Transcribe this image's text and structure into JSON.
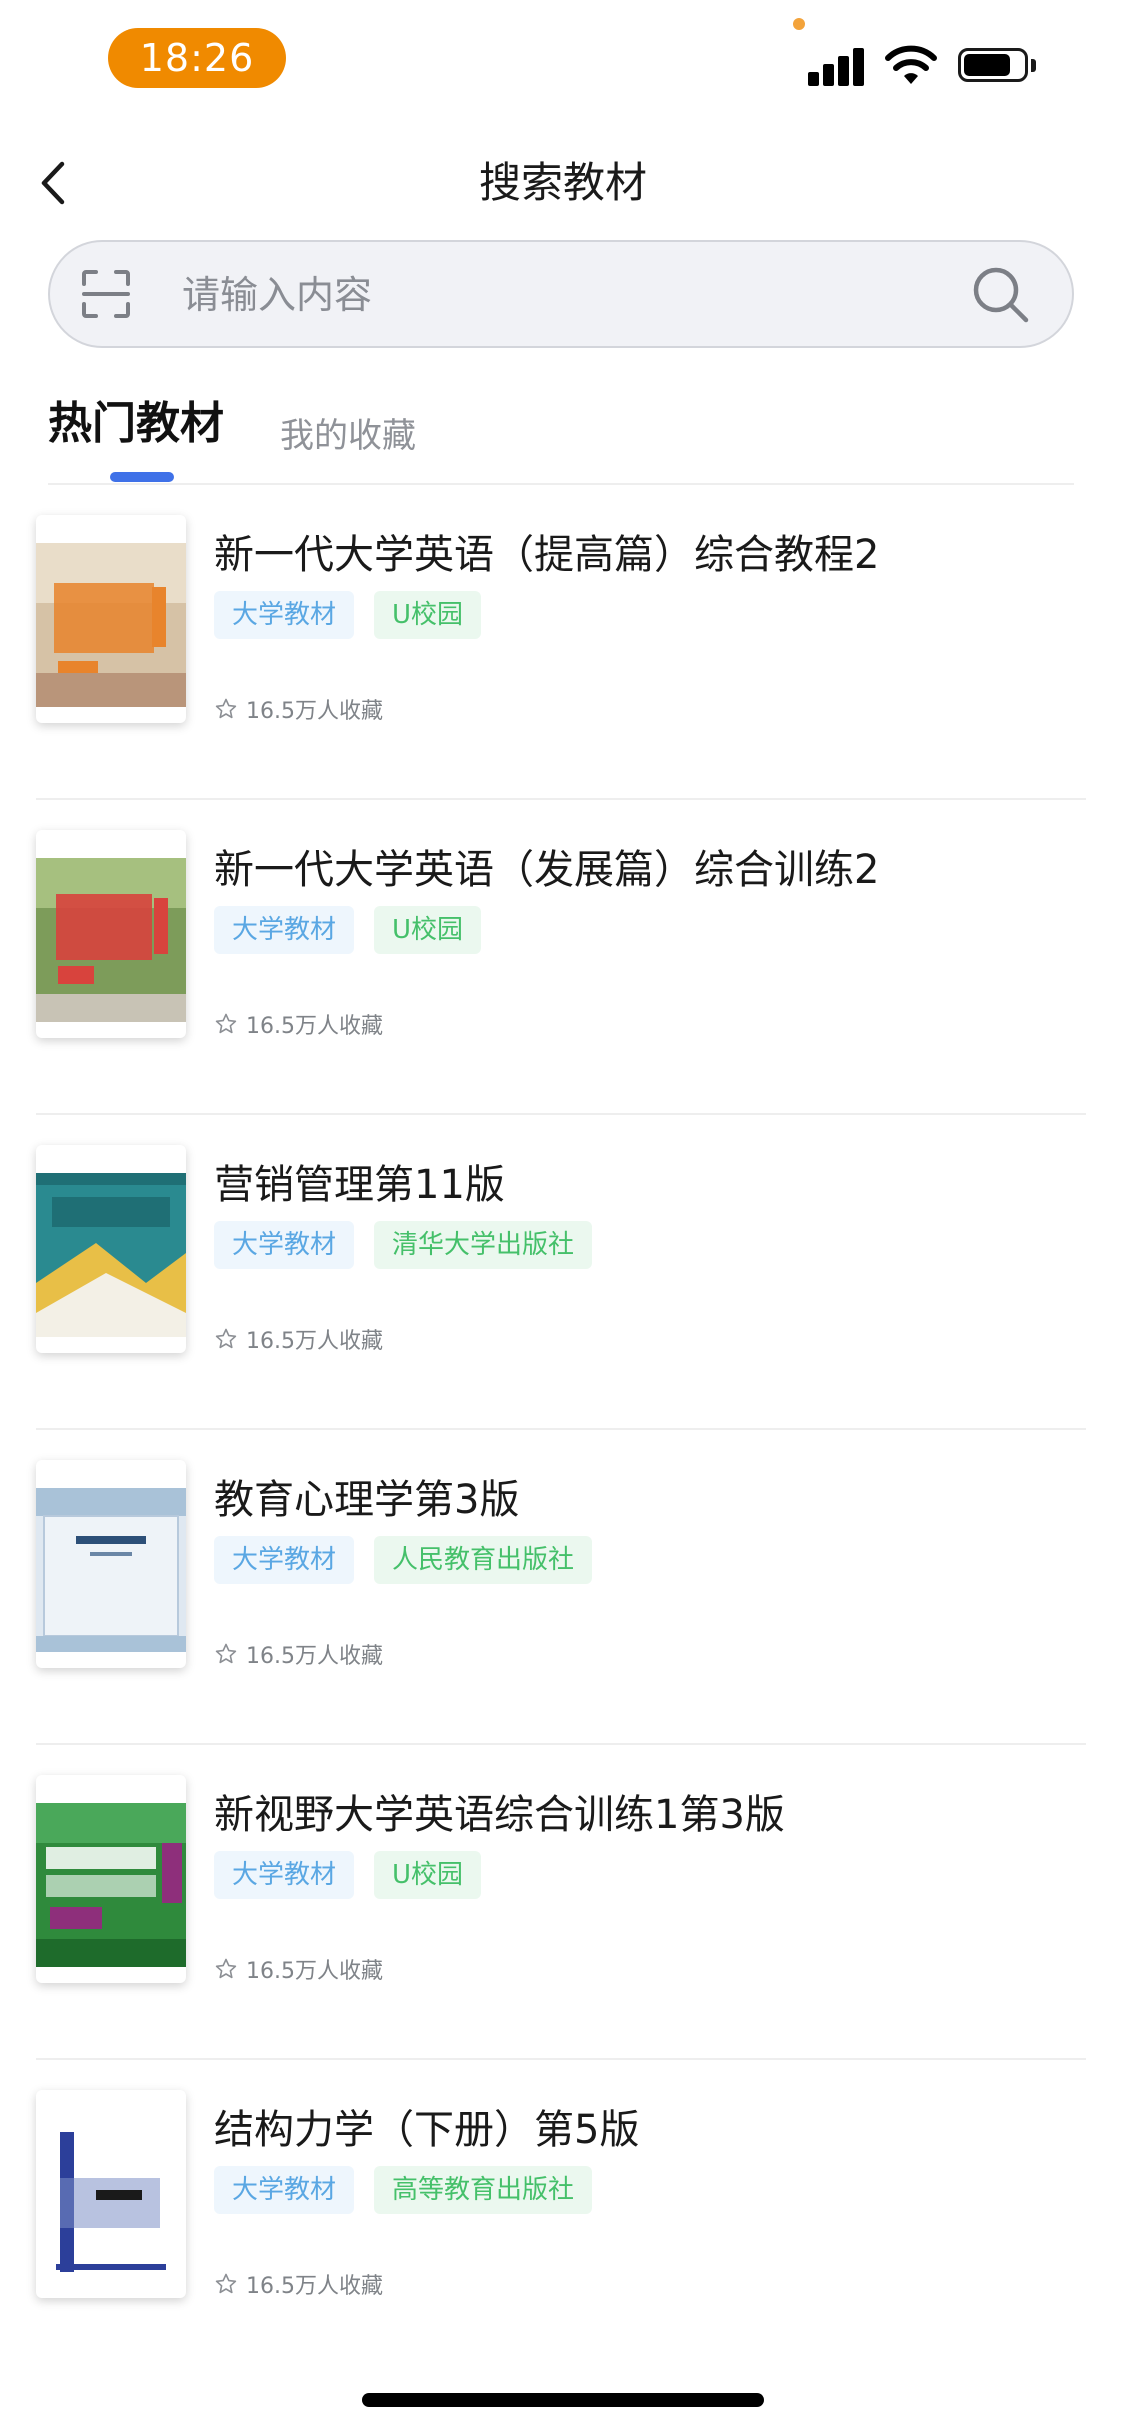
{
  "status_bar": {
    "time": "18:26"
  },
  "header": {
    "title": "搜索教材"
  },
  "search": {
    "placeholder": "请输入内容"
  },
  "tabs": [
    {
      "label": "热门教材",
      "active": true
    },
    {
      "label": "我的收藏",
      "active": false
    }
  ],
  "books": [
    {
      "title": "新一代大学英语（提高篇）综合教程2",
      "tags": [
        "大学教材",
        "U校园"
      ],
      "favorites": "16.5万人收藏",
      "cover_colors": [
        "#c9a57d",
        "#e8842c",
        "#ffffff"
      ]
    },
    {
      "title": "新一代大学英语（发展篇）综合训练2",
      "tags": [
        "大学教材",
        "U校园"
      ],
      "favorites": "16.5万人收藏",
      "cover_colors": [
        "#7d9c5a",
        "#d8433d",
        "#ffffff"
      ]
    },
    {
      "title": "营销管理第11版",
      "tags": [
        "大学教材",
        "清华大学出版社"
      ],
      "favorites": "16.5万人收藏",
      "cover_colors": [
        "#2a8a90",
        "#e8bf47",
        "#ffffff"
      ]
    },
    {
      "title": "教育心理学第3版",
      "tags": [
        "大学教材",
        "人民教育出版社"
      ],
      "favorites": "16.5万人收藏",
      "cover_colors": [
        "#a9c2d8",
        "#dfe8f1",
        "#2c4f78"
      ]
    },
    {
      "title": "新视野大学英语综合训练1第3版",
      "tags": [
        "大学教材",
        "U校园"
      ],
      "favorites": "16.5万人收藏",
      "cover_colors": [
        "#2f8a3c",
        "#8e2f7b",
        "#ffffff"
      ]
    },
    {
      "title": "结构力学（下册）第5版",
      "tags": [
        "大学教材",
        "高等教育出版社"
      ],
      "favorites": "16.5万人收藏",
      "cover_colors": [
        "#2c3f9a",
        "#ffffff",
        "#7d8fc7"
      ]
    }
  ],
  "colors": {
    "accent": "#3f71e8",
    "time_pill": "#f08a00",
    "tag_blue_text": "#5aa7e3",
    "tag_green_text": "#45c06a"
  }
}
